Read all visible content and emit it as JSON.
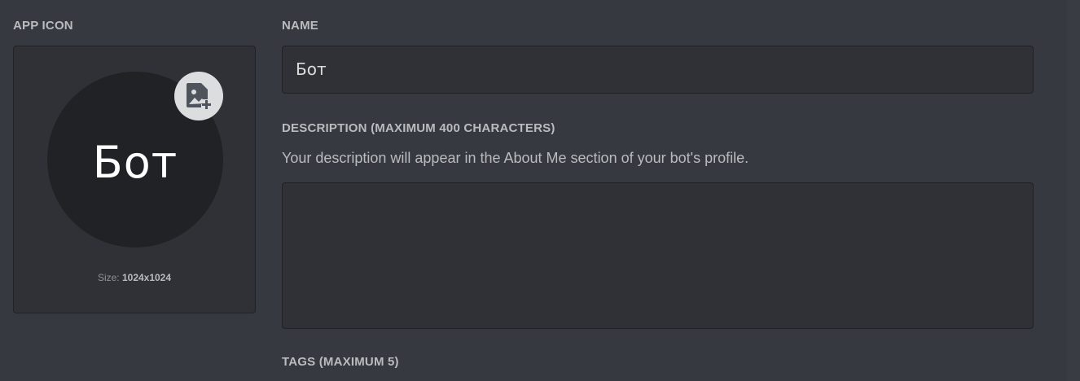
{
  "app_icon": {
    "label": "APP ICON",
    "avatar_text": "Бот",
    "size_prefix": "Size: ",
    "size_value": "1024x1024",
    "upload_icon": "image-add-icon"
  },
  "name": {
    "label": "NAME",
    "value": "Бот"
  },
  "description": {
    "label": "DESCRIPTION (MAXIMUM 400 CHARACTERS)",
    "help": "Your description will appear in the About Me section of your bot's profile.",
    "value": ""
  },
  "tags": {
    "label": "TAGS (MAXIMUM 5)"
  },
  "colors": {
    "background": "#36393f",
    "panel": "#2f3136",
    "avatar": "#202225"
  }
}
